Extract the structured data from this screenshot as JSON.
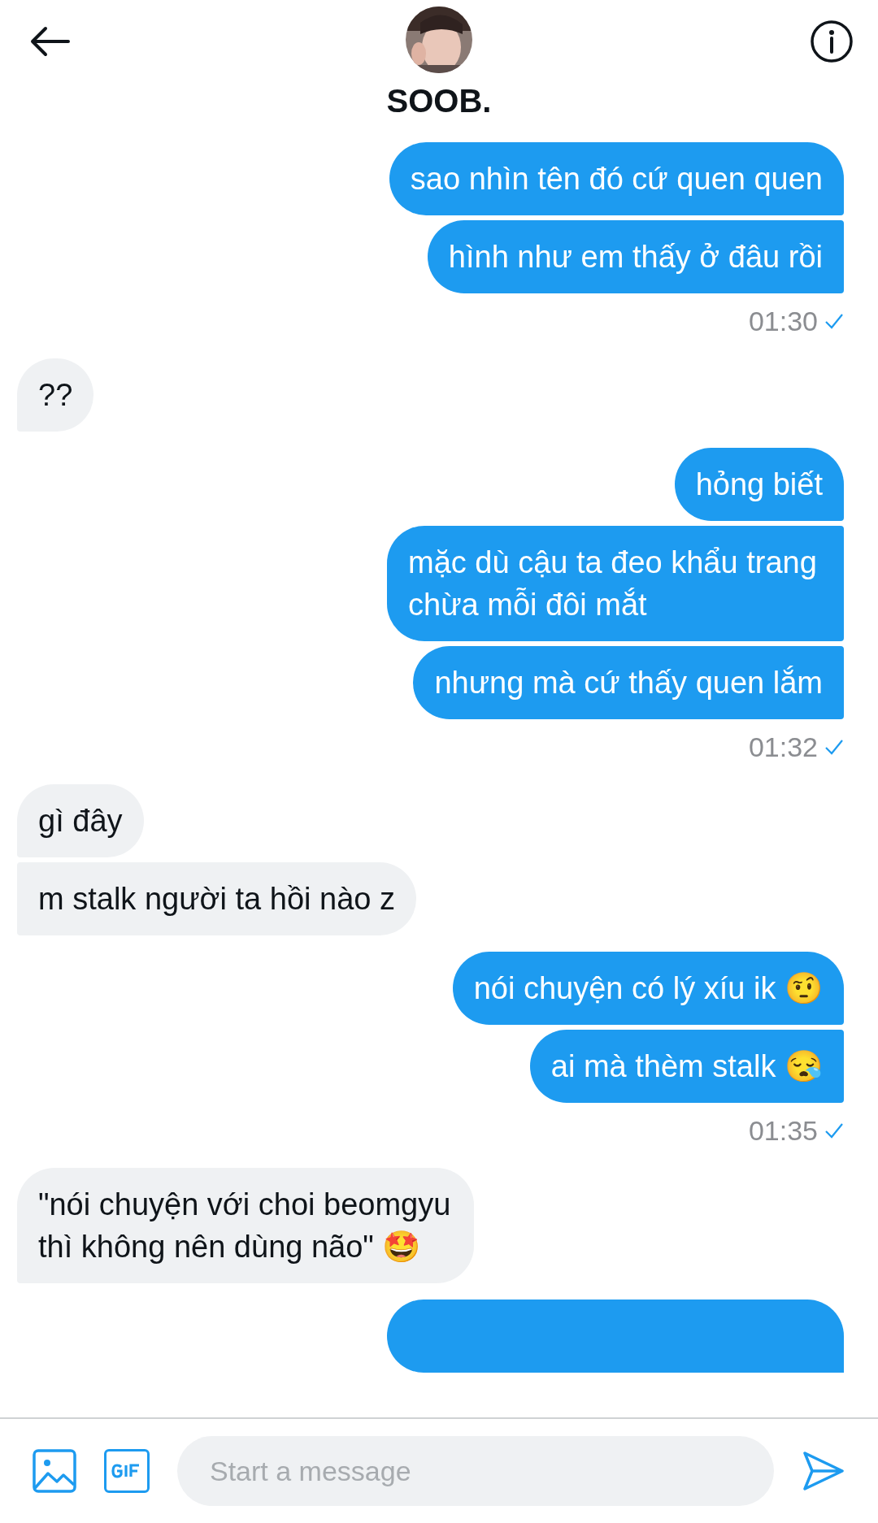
{
  "header": {
    "name": "SOOB."
  },
  "messages": [
    {
      "kind": "sent",
      "text": "sao nhìn tên đó cứ quen quen"
    },
    {
      "kind": "sent",
      "text": "hình như em thấy ở đâu rồi"
    },
    {
      "kind": "time",
      "text": "01:30"
    },
    {
      "kind": "received",
      "text": "??"
    },
    {
      "kind": "sent",
      "text": "hỏng biết"
    },
    {
      "kind": "sent",
      "text": "mặc dù cậu ta đeo khẩu trang chừa mỗi đôi mắt"
    },
    {
      "kind": "sent",
      "text": "nhưng mà cứ thấy quen lắm"
    },
    {
      "kind": "time",
      "text": "01:32"
    },
    {
      "kind": "received",
      "text": "gì đây"
    },
    {
      "kind": "received",
      "text": "m stalk người ta hồi nào z"
    },
    {
      "kind": "sent",
      "text": "nói chuyện có lý xíu ik 🤨"
    },
    {
      "kind": "sent",
      "text": "ai mà thèm stalk 😪"
    },
    {
      "kind": "time",
      "text": "01:35"
    },
    {
      "kind": "received",
      "text": "\"nói chuyện với choi beomgyu thì không nên dùng não\" 🤩"
    },
    {
      "kind": "partial"
    }
  ],
  "composer": {
    "placeholder": "Start a message"
  }
}
